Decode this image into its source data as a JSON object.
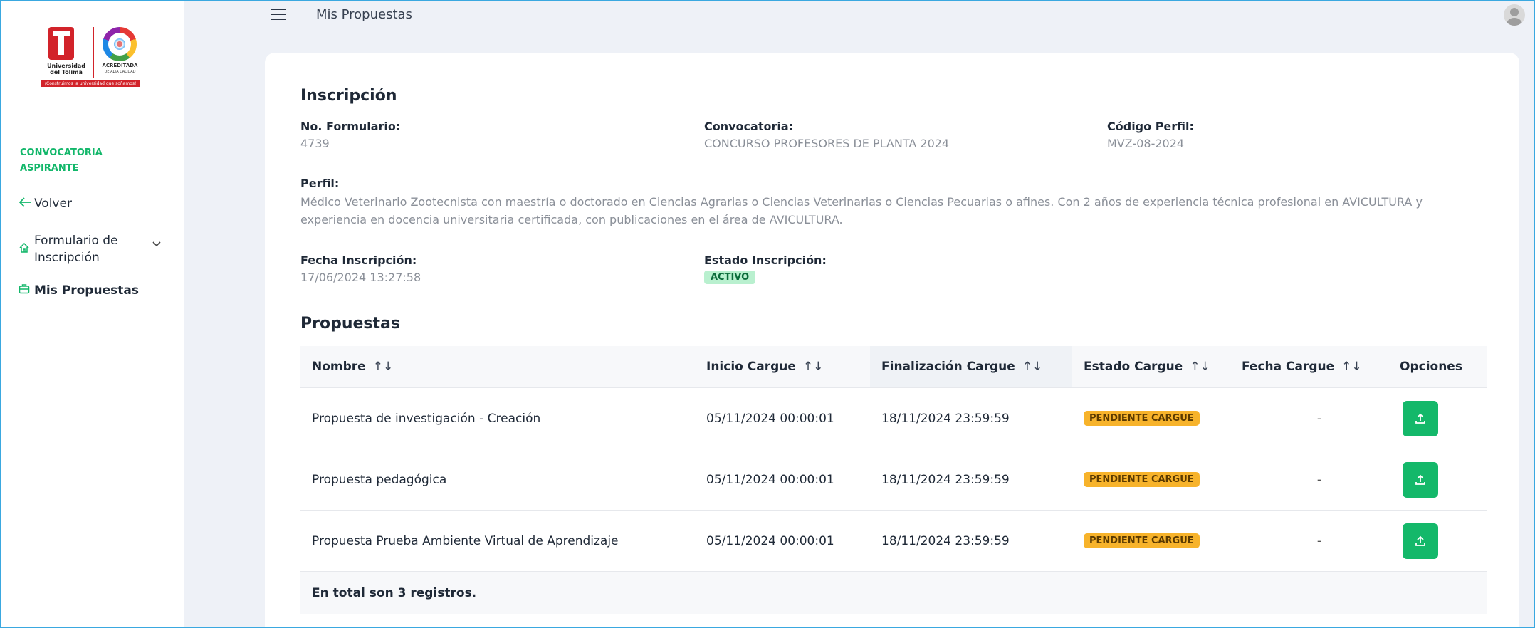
{
  "sidebar": {
    "logo_left_text": "Universidad del Tolima",
    "logo_tagline": "¡Construimos la universidad que soñamos!",
    "logo_right_text": "ACREDITADA",
    "logo_right_sub": "DE ALTA CALIDAD",
    "section_title": "CONVOCATORIA ASPIRANTE",
    "items": [
      {
        "label": "Volver",
        "icon": "arrow-left-icon"
      },
      {
        "label": "Formulario de Inscripción",
        "icon": "home-icon"
      },
      {
        "label": "Mis Propuestas",
        "icon": "briefcase-icon"
      }
    ]
  },
  "header": {
    "title": "Mis Propuestas"
  },
  "inscripcion": {
    "title": "Inscripción",
    "no_formulario_label": "No. Formulario:",
    "no_formulario_value": "4739",
    "convocatoria_label": "Convocatoria:",
    "convocatoria_value": "CONCURSO PROFESORES DE PLANTA 2024",
    "codigo_perfil_label": "Código Perfil:",
    "codigo_perfil_value": "MVZ-08-2024",
    "perfil_label": "Perfil:",
    "perfil_value": "Médico Veterinario Zootecnista con maestría o doctorado en Ciencias Agrarias o Ciencias Veterinarias o Ciencias Pecuarias o afines. Con 2 años de experiencia técnica profesional en AVICULTURA y experiencia en docencia universitaria certificada, con publicaciones en el área de AVICULTURA.",
    "fecha_label": "Fecha Inscripción:",
    "fecha_value": "17/06/2024 13:27:58",
    "estado_label": "Estado Inscripción:",
    "estado_value": "ACTIVO"
  },
  "propuestas": {
    "title": "Propuestas",
    "columns": [
      "Nombre",
      "Inicio Cargue",
      "Finalización Cargue",
      "Estado Cargue",
      "Fecha Cargue",
      "Opciones"
    ],
    "sort_glyph": "↑↓",
    "rows": [
      {
        "nombre": "Propuesta de investigación - Creación",
        "inicio": "05/11/2024 00:00:01",
        "fin": "18/11/2024 23:59:59",
        "estado": "PENDIENTE CARGUE",
        "fecha": "-"
      },
      {
        "nombre": "Propuesta pedagógica",
        "inicio": "05/11/2024 00:00:01",
        "fin": "18/11/2024 23:59:59",
        "estado": "PENDIENTE CARGUE",
        "fecha": "-"
      },
      {
        "nombre": "Propuesta Prueba Ambiente Virtual de Aprendizaje",
        "inicio": "05/11/2024 00:00:01",
        "fin": "18/11/2024 23:59:59",
        "estado": "PENDIENTE CARGUE",
        "fecha": "-"
      }
    ],
    "footer": "En total son 3 registros."
  },
  "colors": {
    "accent": "#14b86a",
    "pending": "#f7b32b",
    "active_badge": "#b9f0cf"
  }
}
